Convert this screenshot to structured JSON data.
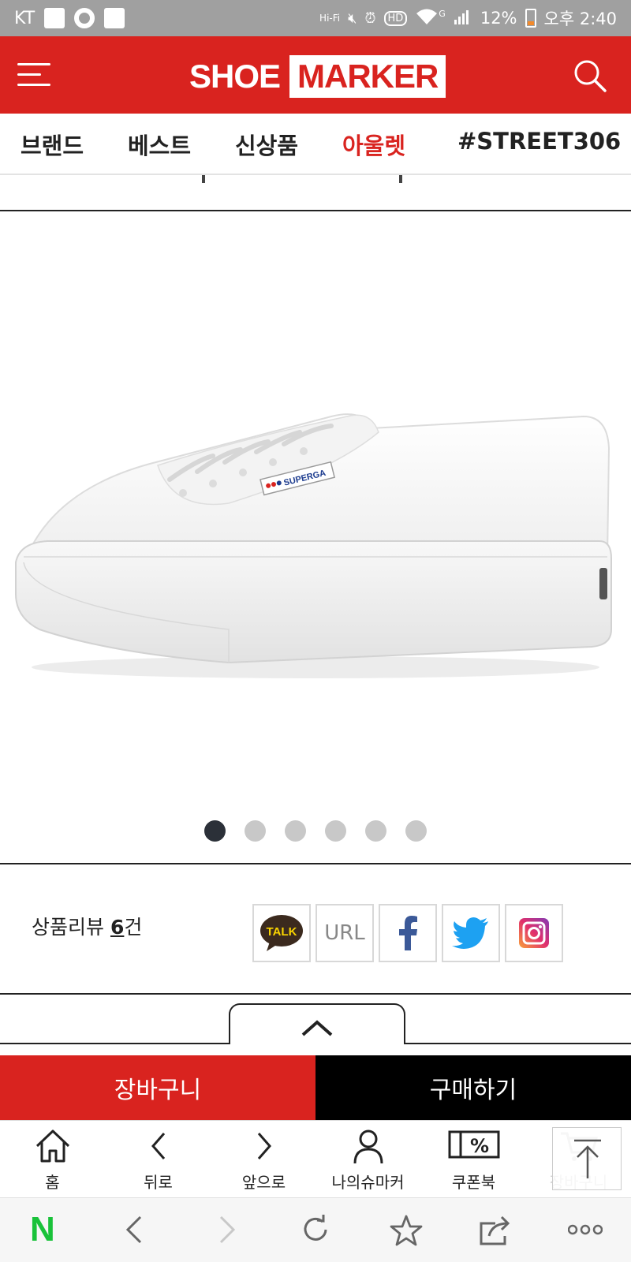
{
  "status_bar": {
    "carrier": "KT",
    "hifi": "Hi-Fi",
    "hd": "HD",
    "network": "G",
    "battery": "12%",
    "time": "오후 2:40"
  },
  "header": {
    "logo_part1": "SHOE",
    "logo_part2": "MARKER",
    "brand_color": "#d9231f"
  },
  "nav": {
    "items": [
      {
        "label": "브랜드",
        "active": false
      },
      {
        "label": "베스트",
        "active": false
      },
      {
        "label": "신상품",
        "active": false
      },
      {
        "label": "아울렛",
        "active": true
      },
      {
        "label": "#STREET306",
        "active": false
      }
    ]
  },
  "product": {
    "image_brand_label": "SUPERGA",
    "slides_total": 6,
    "active_slide": 1
  },
  "review": {
    "label": "상품리뷰",
    "count": "6",
    "suffix": "건"
  },
  "share": {
    "talk_label": "TALK",
    "url_label": "URL"
  },
  "actions": {
    "cart_label": "장바구니",
    "buy_label": "구매하기"
  },
  "tabbar": {
    "home": "홈",
    "back": "뒤로",
    "forward": "앞으로",
    "my": "나의슈마커",
    "coupon": "쿠폰북",
    "cart": "장바구니"
  },
  "browser": {
    "logo": "N"
  }
}
